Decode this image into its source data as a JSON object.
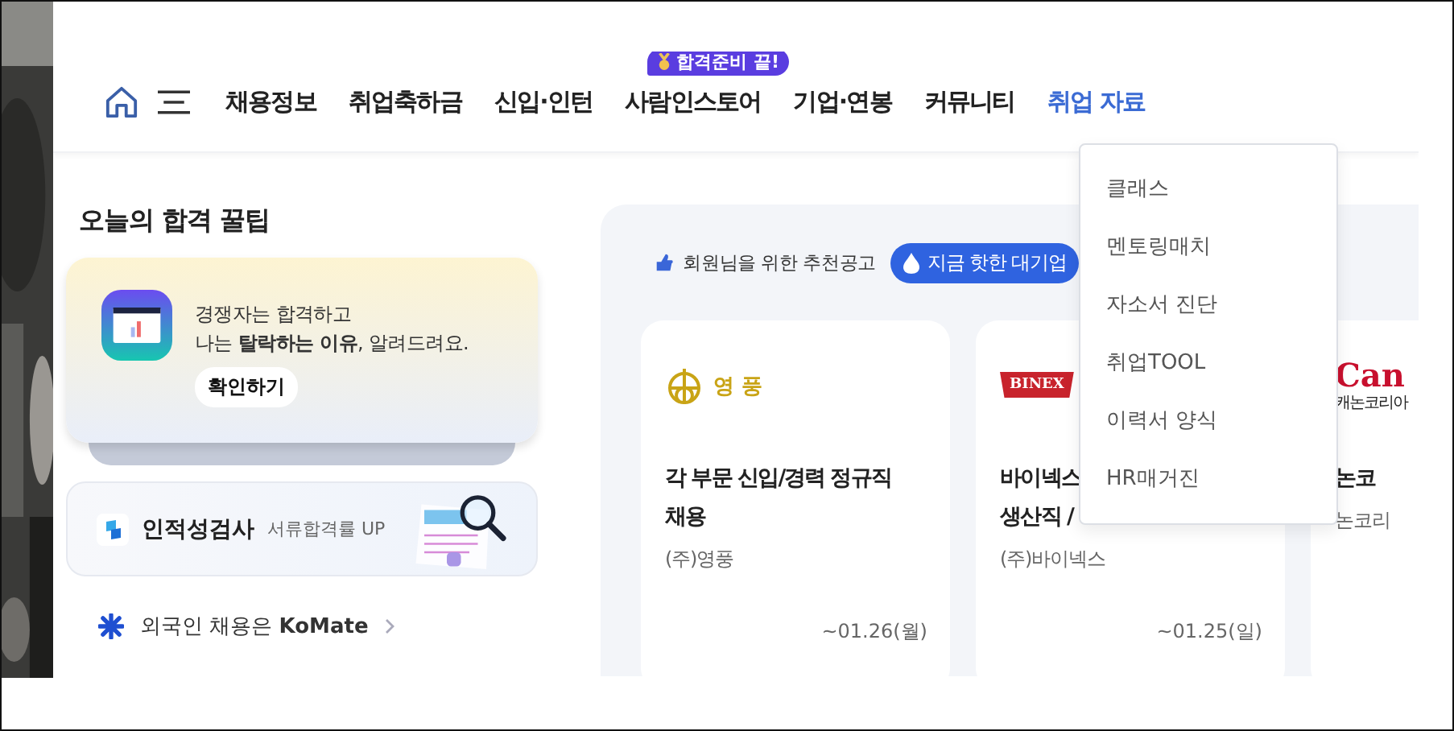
{
  "header": {
    "nav": [
      {
        "label": "채용정보",
        "selected": false
      },
      {
        "label": "취업축하금",
        "selected": false
      },
      {
        "label": "신입·인턴",
        "selected": false
      },
      {
        "label": "사람인스토어",
        "selected": false,
        "badge": "합격준비 끝!"
      },
      {
        "label": "기업·연봉",
        "selected": false
      },
      {
        "label": "커뮤니티",
        "selected": false
      },
      {
        "label": "취업 자료",
        "selected": true
      }
    ]
  },
  "dropdown": {
    "items": [
      "클래스",
      "멘토링매치",
      "자소서 진단",
      "취업TOOL",
      "이력서 양식",
      "HR매거진"
    ]
  },
  "tips": {
    "title": "오늘의 합격 꿀팁",
    "promo": {
      "lines": [
        "경쟁자는 합격하고",
        "나는 **탈락하는 이유**, 알려드려요."
      ],
      "button": "확인하기"
    },
    "test": {
      "title": "인적성검사",
      "subtitle": "서류합격률 UP"
    },
    "link": "외국인 채용은 **KoMate**"
  },
  "recommend": {
    "heading": "회원님을 위한 추천공고",
    "tabs": [
      {
        "label": "지금 핫한 대기업",
        "selected": true
      }
    ],
    "cards": [
      {
        "logo": {
          "kind": "emblem",
          "text": "영 풍"
        },
        "title": [
          "각 부문 신입/경력 정규직",
          "채용"
        ],
        "company": "(주)영풍",
        "deadline": "~01.26(월)"
      },
      {
        "logo": {
          "kind": "ribbon",
          "text": "BINEX"
        },
        "title": [
          "바이넥스",
          "생산직 /"
        ],
        "company": "(주)바이넥스",
        "deadline": "~01.25(일)"
      },
      {
        "logo": {
          "kind": "wordmark",
          "text": "Can",
          "subtext": "캐논코리아"
        },
        "title": [
          "논코"
        ],
        "company": "논코리"
      }
    ]
  }
}
